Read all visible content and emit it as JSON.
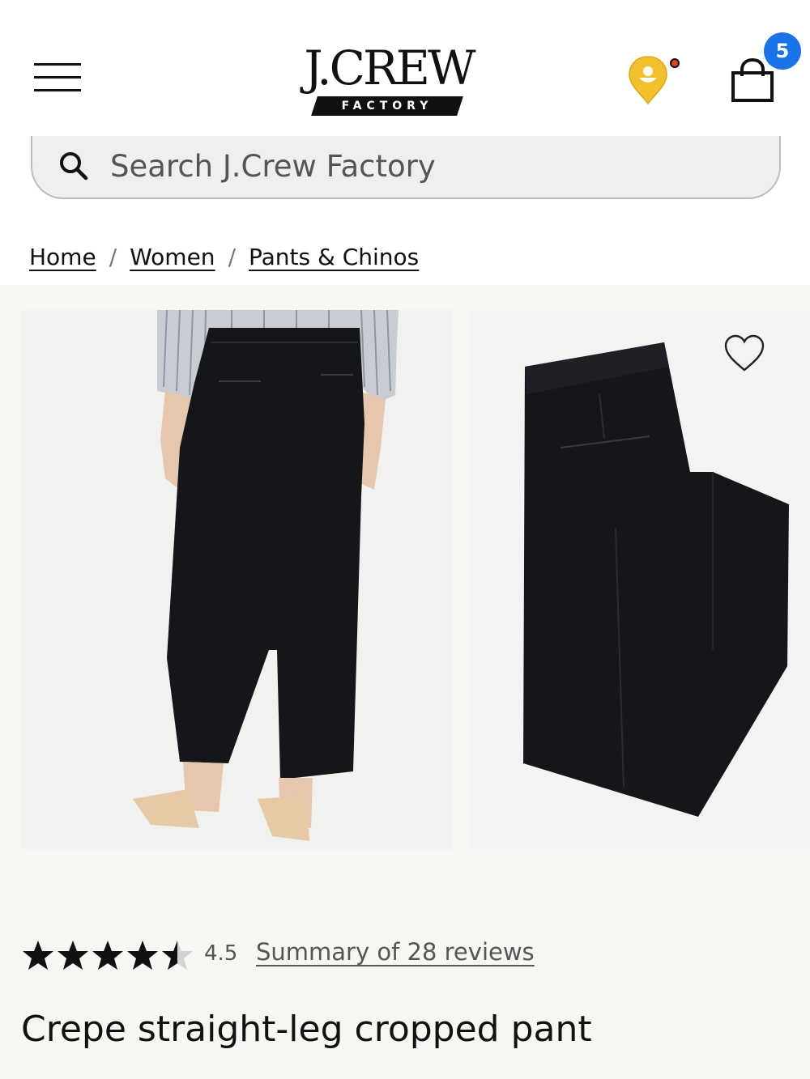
{
  "header": {
    "logo_text": "J.CREW",
    "logo_subtext": "FACTORY",
    "cart_count": "5",
    "icons": {
      "menu": "hamburger-menu-icon",
      "rewards": "rewards-face-icon",
      "bag": "shopping-bag-icon"
    }
  },
  "search": {
    "placeholder": "Search J.Crew Factory",
    "icon": "search-icon"
  },
  "breadcrumb": {
    "items": [
      "Home",
      "Women",
      "Pants & Chinos"
    ],
    "separator": "/"
  },
  "product": {
    "rating_value": "4.5",
    "rating_stars": 4.5,
    "rating_max": 5,
    "reviews_link": "Summary of 28 reviews",
    "title": "Crepe straight-leg cropped pant",
    "wishlist_icon": "heart-icon"
  },
  "colors": {
    "badge": "#1a73e8",
    "rewards_yellow": "#f2c02c",
    "rewards_dot": "#e0412b",
    "gallery_bg": "#f7f6f3",
    "pants": "#15161a"
  }
}
